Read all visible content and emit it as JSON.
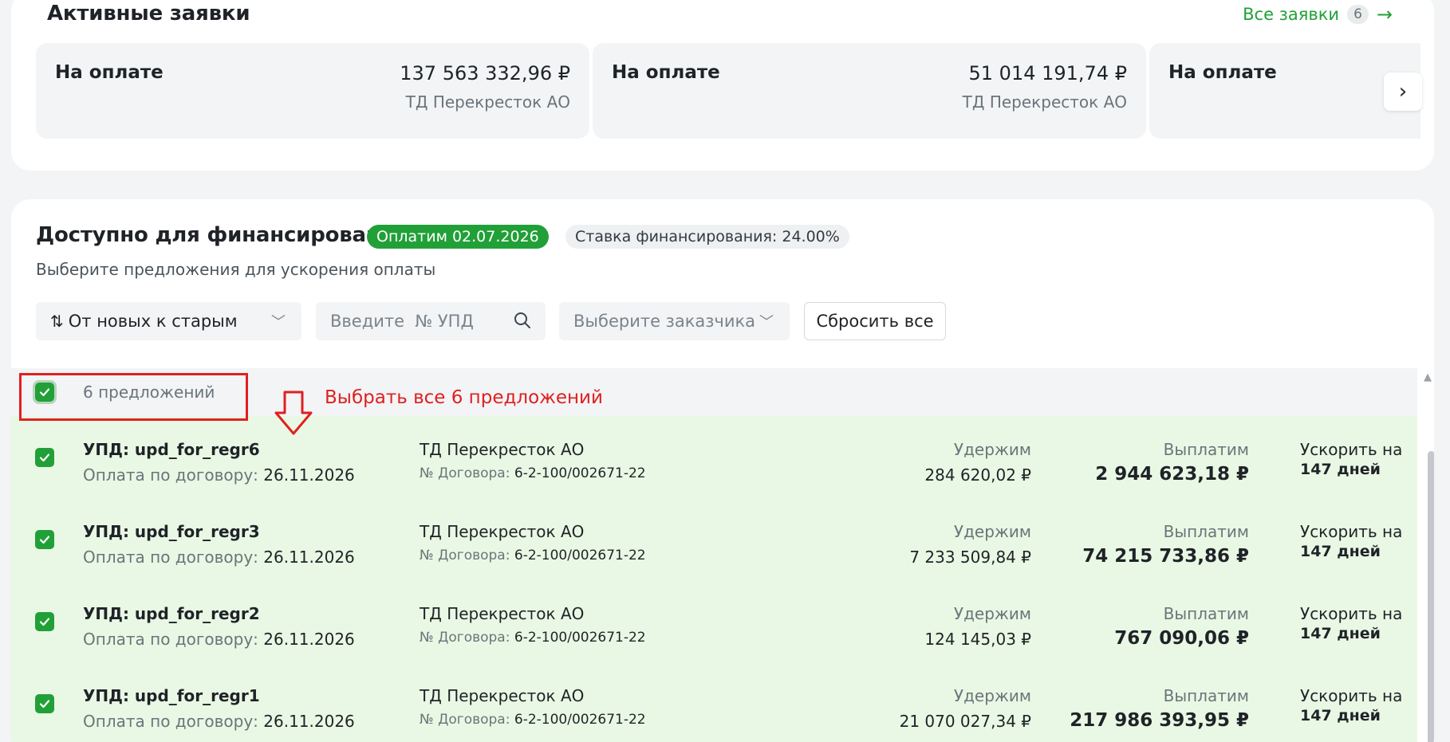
{
  "active": {
    "title": "Активные заявки",
    "all_link": "Все заявки",
    "all_count": "6",
    "cards": [
      {
        "status": "На оплате",
        "amount": "137 563 332,96 ₽",
        "company": "ТД Перекресток АО"
      },
      {
        "status": "На оплате",
        "amount": "51 014 191,74 ₽",
        "company": "ТД Перекресток АО"
      },
      {
        "status": "На оплате"
      }
    ]
  },
  "financing": {
    "title": "Доступно для финансирования",
    "pay_badge": "Оплатим 02.07.2026",
    "rate_badge": "Ставка финансирования: 24.00%",
    "subtitle": "Выберите предложения для ускорения оплаты",
    "filters": {
      "sort_label": "От новых к старым",
      "search_placeholder": "Введите  № УПД",
      "customer_placeholder": "Выберите заказчика",
      "reset_label": "Сбросить все"
    },
    "select_all_label": "6 предложений",
    "hint_text": "Выбрать все 6 предложений",
    "columns": {
      "hold": "Удержим",
      "payout": "Выплатим",
      "speed": "Ускорить на",
      "pay_label": "Оплата по договору:",
      "contract_label": "№ Договора:"
    },
    "offers": [
      {
        "upd": "УПД: upd_for_regr6",
        "pay_date": "26.11.2026",
        "customer": "ТД Перекресток АО",
        "contract": "6-2-100/002671-22",
        "hold": "284 620,02 ₽",
        "payout": "2 944 623,18 ₽",
        "days": "147 дней",
        "checked": true
      },
      {
        "upd": "УПД: upd_for_regr3",
        "pay_date": "26.11.2026",
        "customer": "ТД Перекресток АО",
        "contract": "6-2-100/002671-22",
        "hold": "7 233 509,84 ₽",
        "payout": "74 215 733,86 ₽",
        "days": "147 дней",
        "checked": true
      },
      {
        "upd": "УПД: upd_for_regr2",
        "pay_date": "26.11.2026",
        "customer": "ТД Перекресток АО",
        "contract": "6-2-100/002671-22",
        "hold": "124 145,03 ₽",
        "payout": "767 090,06 ₽",
        "days": "147 дней",
        "checked": true
      },
      {
        "upd": "УПД: upd_for_regr1",
        "pay_date": "26.11.2026",
        "customer": "ТД Перекресток АО",
        "contract": "6-2-100/002671-22",
        "hold": "21 070 027,34 ₽",
        "payout": "217 986 393,95 ₽",
        "days": "147 дней",
        "checked": true
      }
    ]
  },
  "colors": {
    "accent_green": "#21a038",
    "row_selected_bg": "#e9f8e4",
    "annotation_red": "#e02020"
  },
  "icons": {
    "next": "chevron-right-icon",
    "arrow": "arrow-right-icon",
    "sort": "sort-arrows-icon",
    "dropdown": "chevron-down-icon",
    "search": "search-icon",
    "check": "check-icon",
    "annotation": "down-arrow-icon"
  }
}
